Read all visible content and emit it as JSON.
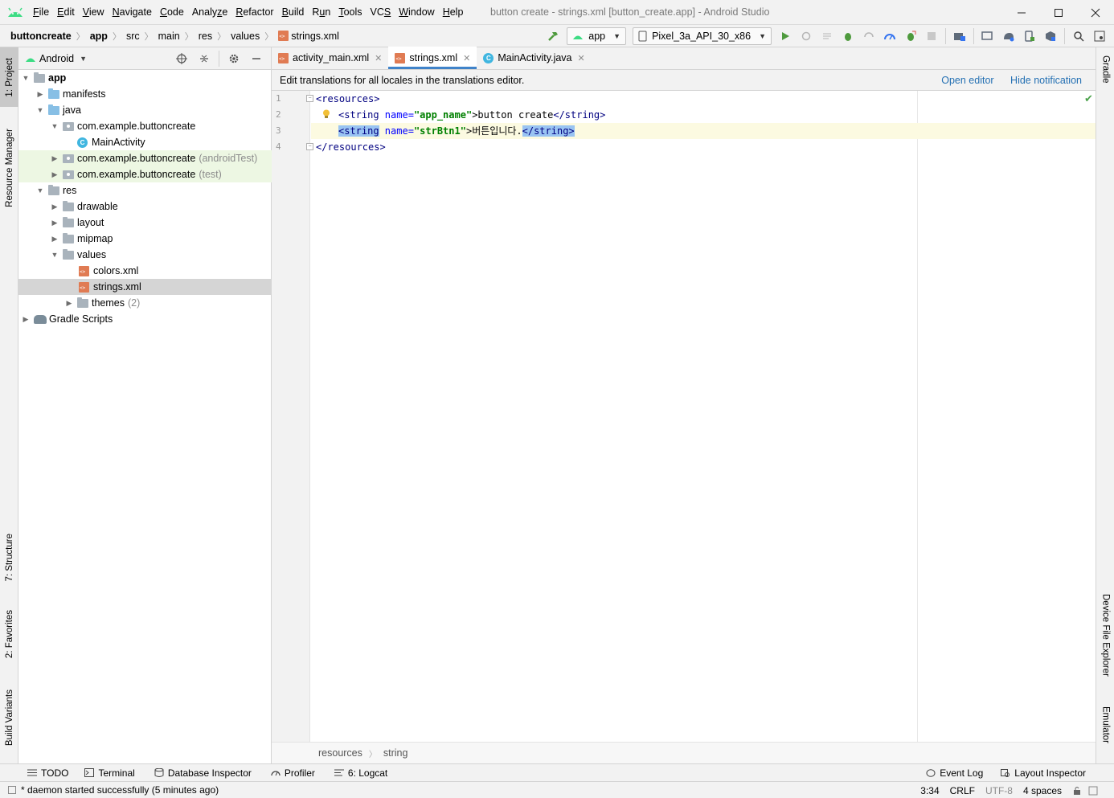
{
  "menu": [
    "File",
    "Edit",
    "View",
    "Navigate",
    "Code",
    "Analyze",
    "Refactor",
    "Build",
    "Run",
    "Tools",
    "VCS",
    "Window",
    "Help"
  ],
  "menu_underline": [
    "F",
    "E",
    "V",
    "N",
    "C",
    "z",
    "R",
    "B",
    "u",
    "T",
    "S",
    "W",
    "H"
  ],
  "window_title": "button create - strings.xml [button_create.app] - Android Studio",
  "breadcrumbs": [
    "buttoncreate",
    "app",
    "src",
    "main",
    "res",
    "values",
    "strings.xml"
  ],
  "toolbar": {
    "run_config": "app",
    "device": "Pixel_3a_API_30_x86"
  },
  "left_tabs": [
    "1: Project",
    "Resource Manager",
    "7: Structure",
    "2: Favorites",
    "Build Variants"
  ],
  "right_tabs": [
    "Gradle",
    "Device File Explorer",
    "Emulator"
  ],
  "project": {
    "view_mode": "Android",
    "tree": [
      {
        "label": "app",
        "suffix": ""
      },
      {
        "label": "manifests",
        "suffix": ""
      },
      {
        "label": "java",
        "suffix": ""
      },
      {
        "label": "com.example.buttoncreate",
        "suffix": ""
      },
      {
        "label": "MainActivity",
        "suffix": ""
      },
      {
        "label": "com.example.buttoncreate",
        "suffix": "(androidTest)"
      },
      {
        "label": "com.example.buttoncreate",
        "suffix": "(test)"
      },
      {
        "label": "res",
        "suffix": ""
      },
      {
        "label": "drawable",
        "suffix": ""
      },
      {
        "label": "layout",
        "suffix": ""
      },
      {
        "label": "mipmap",
        "suffix": ""
      },
      {
        "label": "values",
        "suffix": ""
      },
      {
        "label": "colors.xml",
        "suffix": ""
      },
      {
        "label": "strings.xml",
        "suffix": ""
      },
      {
        "label": "themes",
        "suffix": "(2)"
      },
      {
        "label": "Gradle Scripts",
        "suffix": ""
      }
    ]
  },
  "editor": {
    "tabs": [
      "activity_main.xml",
      "strings.xml",
      "MainActivity.java"
    ],
    "active_tab": "strings.xml",
    "notification": "Edit translations for all locales in the translations editor.",
    "open_editor": "Open editor",
    "hide_notification": "Hide notification",
    "line_numbers": [
      "1",
      "2",
      "3",
      "4"
    ],
    "code": {
      "l1": "<resources>",
      "l2_open": "<string",
      "l2_attr": " name=",
      "l2_val": "\"app_name\"",
      "l2_text": ">button create",
      "l2_close": "</string>",
      "l3_open": "<string",
      "l3_attr": " name=",
      "l3_val": "\"strBtn1\"",
      "l3_text": ">버튼입니다.",
      "l3_close": "</string>",
      "l4": "</resources>"
    },
    "crumbs": [
      "resources",
      "string"
    ]
  },
  "bottom_tools": [
    "TODO",
    "Terminal",
    "Database Inspector",
    "Profiler",
    "6: Logcat"
  ],
  "bottom_tools_right": [
    "Event Log",
    "Layout Inspector"
  ],
  "status": {
    "message": "* daemon started successfully (5 minutes ago)",
    "position": "3:34",
    "line_sep": "CRLF",
    "encoding": "UTF-8",
    "indent": "4 spaces"
  },
  "colors": {
    "accent": "#4083c9",
    "link": "#2470b3",
    "xml_tag": "#000080",
    "xml_attr": "#0000ff",
    "xml_value": "#008000",
    "selection": "#99c4f2"
  }
}
